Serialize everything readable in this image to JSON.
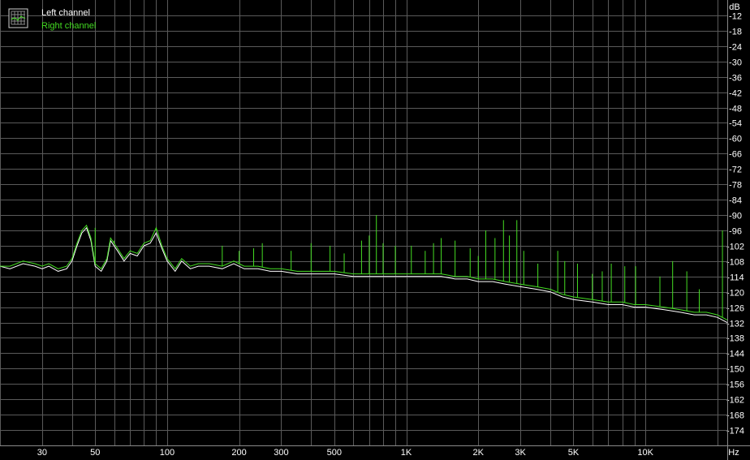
{
  "chart_data": {
    "type": "line",
    "title": "",
    "xlabel": "",
    "ylabel": "",
    "x_unit": "Hz",
    "y_unit": "dB",
    "x_scale": "log",
    "xlim": [
      20,
      22000
    ],
    "ylim": [
      -180,
      -6
    ],
    "y_ticks": [
      -12,
      -18,
      -24,
      -30,
      -36,
      -42,
      -48,
      -54,
      -60,
      -66,
      -72,
      -78,
      -84,
      -90,
      -96,
      -102,
      -108,
      -114,
      -120,
      -126,
      -132,
      -138,
      -144,
      -150,
      -156,
      -162,
      -168,
      -174
    ],
    "x_tick_labels": [
      {
        "value": 30,
        "label": "30"
      },
      {
        "value": 50,
        "label": "50"
      },
      {
        "value": 100,
        "label": "100"
      },
      {
        "value": 200,
        "label": "200"
      },
      {
        "value": 300,
        "label": "300"
      },
      {
        "value": 500,
        "label": "500"
      },
      {
        "value": 1000,
        "label": "1K"
      },
      {
        "value": 2000,
        "label": "2K"
      },
      {
        "value": 3000,
        "label": "3K"
      },
      {
        "value": 5000,
        "label": "5K"
      },
      {
        "value": 10000,
        "label": "10K"
      }
    ],
    "grid": true,
    "legend_position": "top-left",
    "series": [
      {
        "name": "Left channel",
        "color": "#ffffff",
        "points": [
          [
            20,
            -110
          ],
          [
            22,
            -111
          ],
          [
            25,
            -109
          ],
          [
            28,
            -110
          ],
          [
            30,
            -111
          ],
          [
            32,
            -110
          ],
          [
            35,
            -112
          ],
          [
            38,
            -111
          ],
          [
            40,
            -108
          ],
          [
            42,
            -102
          ],
          [
            44,
            -97
          ],
          [
            46,
            -95
          ],
          [
            48,
            -100
          ],
          [
            50,
            -110
          ],
          [
            53,
            -112
          ],
          [
            56,
            -108
          ],
          [
            58,
            -100
          ],
          [
            62,
            -104
          ],
          [
            66,
            -108
          ],
          [
            70,
            -105
          ],
          [
            75,
            -106
          ],
          [
            80,
            -102
          ],
          [
            85,
            -101
          ],
          [
            90,
            -97
          ],
          [
            95,
            -103
          ],
          [
            100,
            -108
          ],
          [
            108,
            -112
          ],
          [
            115,
            -108
          ],
          [
            125,
            -111
          ],
          [
            135,
            -110
          ],
          [
            150,
            -110
          ],
          [
            170,
            -111
          ],
          [
            190,
            -109
          ],
          [
            210,
            -111
          ],
          [
            240,
            -111
          ],
          [
            270,
            -112
          ],
          [
            300,
            -112
          ],
          [
            350,
            -113
          ],
          [
            400,
            -113
          ],
          [
            450,
            -113
          ],
          [
            500,
            -113
          ],
          [
            600,
            -114
          ],
          [
            700,
            -114
          ],
          [
            800,
            -114
          ],
          [
            900,
            -114
          ],
          [
            1000,
            -114
          ],
          [
            1200,
            -114
          ],
          [
            1400,
            -114
          ],
          [
            1600,
            -115
          ],
          [
            1800,
            -115
          ],
          [
            2000,
            -116
          ],
          [
            2300,
            -116
          ],
          [
            2600,
            -117
          ],
          [
            3000,
            -118
          ],
          [
            3500,
            -119
          ],
          [
            4000,
            -120
          ],
          [
            4500,
            -122
          ],
          [
            5000,
            -123
          ],
          [
            6000,
            -124
          ],
          [
            7000,
            -125
          ],
          [
            8000,
            -125
          ],
          [
            9000,
            -126
          ],
          [
            10000,
            -126
          ],
          [
            12000,
            -127
          ],
          [
            14000,
            -128
          ],
          [
            16000,
            -129
          ],
          [
            18000,
            -129
          ],
          [
            20000,
            -130
          ],
          [
            22000,
            -132
          ]
        ]
      },
      {
        "name": "Right channel",
        "color": "#44dd22",
        "points": [
          [
            20,
            -110
          ],
          [
            22,
            -110
          ],
          [
            25,
            -108
          ],
          [
            28,
            -109
          ],
          [
            30,
            -110
          ],
          [
            32,
            -109
          ],
          [
            35,
            -111
          ],
          [
            38,
            -110
          ],
          [
            40,
            -107
          ],
          [
            42,
            -101
          ],
          [
            44,
            -96
          ],
          [
            46,
            -94
          ],
          [
            48,
            -99
          ],
          [
            50,
            -109
          ],
          [
            53,
            -111
          ],
          [
            56,
            -107
          ],
          [
            58,
            -99
          ],
          [
            62,
            -103
          ],
          [
            66,
            -107
          ],
          [
            70,
            -104
          ],
          [
            75,
            -105
          ],
          [
            80,
            -101
          ],
          [
            85,
            -100
          ],
          [
            90,
            -95
          ],
          [
            95,
            -102
          ],
          [
            100,
            -107
          ],
          [
            108,
            -111
          ],
          [
            115,
            -107
          ],
          [
            125,
            -110
          ],
          [
            135,
            -109
          ],
          [
            150,
            -109
          ],
          [
            170,
            -110
          ],
          [
            190,
            -108
          ],
          [
            210,
            -110
          ],
          [
            240,
            -110
          ],
          [
            270,
            -111
          ],
          [
            300,
            -111
          ],
          [
            350,
            -112
          ],
          [
            400,
            -112
          ],
          [
            450,
            -112
          ],
          [
            500,
            -112
          ],
          [
            600,
            -113
          ],
          [
            700,
            -113
          ],
          [
            800,
            -113
          ],
          [
            900,
            -113
          ],
          [
            1000,
            -113
          ],
          [
            1200,
            -113
          ],
          [
            1400,
            -113
          ],
          [
            1600,
            -114
          ],
          [
            1800,
            -114
          ],
          [
            2000,
            -115
          ],
          [
            2300,
            -115
          ],
          [
            2600,
            -116
          ],
          [
            3000,
            -117
          ],
          [
            3500,
            -118
          ],
          [
            4000,
            -119
          ],
          [
            4500,
            -121
          ],
          [
            5000,
            -122
          ],
          [
            6000,
            -123
          ],
          [
            7000,
            -124
          ],
          [
            8000,
            -124
          ],
          [
            9000,
            -125
          ],
          [
            10000,
            -125
          ],
          [
            12000,
            -126
          ],
          [
            14000,
            -127
          ],
          [
            16000,
            -128
          ],
          [
            18000,
            -128
          ],
          [
            20000,
            -129
          ],
          [
            22000,
            -131
          ]
        ],
        "spikes": [
          [
            50,
            -95
          ],
          [
            60,
            -100
          ],
          [
            90,
            -96
          ],
          [
            170,
            -102
          ],
          [
            200,
            -104
          ],
          [
            230,
            -103
          ],
          [
            250,
            -101
          ],
          [
            330,
            -104
          ],
          [
            400,
            -101
          ],
          [
            480,
            -102
          ],
          [
            550,
            -105
          ],
          [
            650,
            -100
          ],
          [
            700,
            -98
          ],
          [
            750,
            -90
          ],
          [
            800,
            -101
          ],
          [
            900,
            -102
          ],
          [
            1050,
            -102
          ],
          [
            1200,
            -104
          ],
          [
            1300,
            -101
          ],
          [
            1400,
            -99
          ],
          [
            1600,
            -100
          ],
          [
            1850,
            -103
          ],
          [
            2000,
            -106
          ],
          [
            2150,
            -96
          ],
          [
            2350,
            -99
          ],
          [
            2550,
            -92
          ],
          [
            2700,
            -98
          ],
          [
            2900,
            -92
          ],
          [
            3100,
            -104
          ],
          [
            3550,
            -109
          ],
          [
            4300,
            -104
          ],
          [
            4600,
            -108
          ],
          [
            5200,
            -109
          ],
          [
            6000,
            -113
          ],
          [
            6600,
            -112
          ],
          [
            7200,
            -109
          ],
          [
            8200,
            -110
          ],
          [
            9100,
            -110
          ],
          [
            11500,
            -114
          ],
          [
            13000,
            -108
          ],
          [
            14900,
            -112
          ],
          [
            16800,
            -119
          ],
          [
            21000,
            -96
          ]
        ]
      }
    ]
  }
}
